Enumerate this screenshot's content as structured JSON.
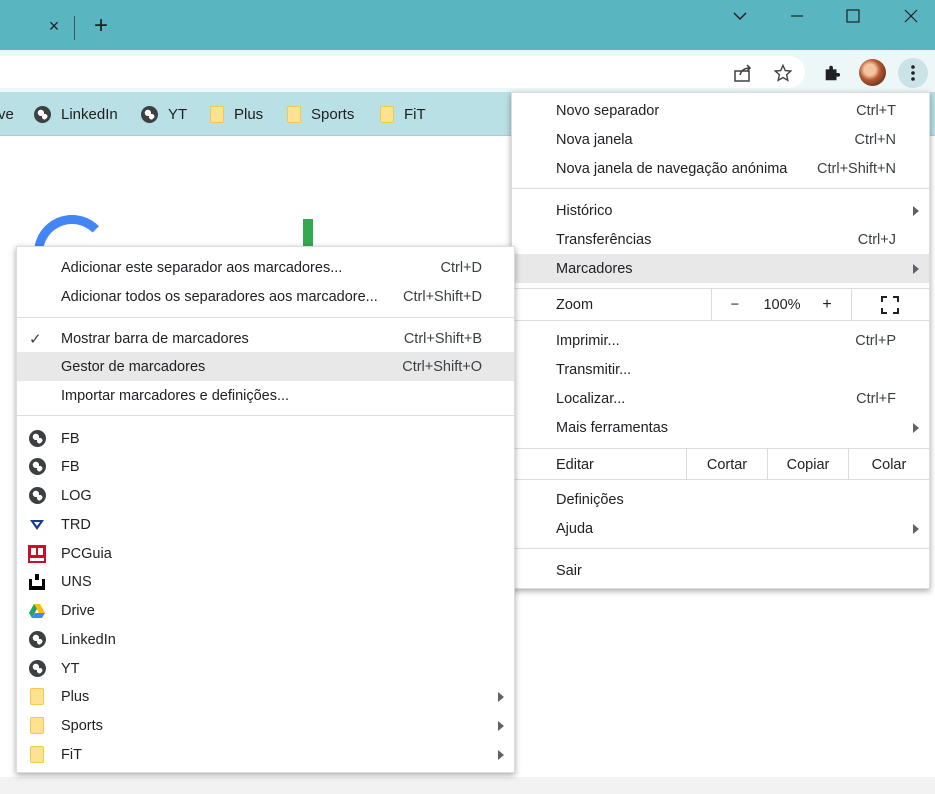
{
  "window": {
    "tab_close_glyph": "×",
    "new_tab_glyph": "+"
  },
  "bookmarks_bar": [
    {
      "label": "ve",
      "icon": "google-drive-icon"
    },
    {
      "label": "LinkedIn",
      "icon": "globe-icon"
    },
    {
      "label": "YT",
      "icon": "globe-icon"
    },
    {
      "label": "Plus",
      "icon": "folder-icon"
    },
    {
      "label": "Sports",
      "icon": "folder-icon"
    },
    {
      "label": "FiT",
      "icon": "folder-icon"
    }
  ],
  "main_menu": {
    "new_tab": {
      "label": "Novo separador",
      "shortcut": "Ctrl+T"
    },
    "new_window": {
      "label": "Nova janela",
      "shortcut": "Ctrl+N"
    },
    "incognito": {
      "label": "Nova janela de navegação anónima",
      "shortcut": "Ctrl+Shift+N"
    },
    "history": {
      "label": "Histórico"
    },
    "downloads": {
      "label": "Transferências",
      "shortcut": "Ctrl+J"
    },
    "bookmarks": {
      "label": "Marcadores"
    },
    "zoom": {
      "label": "Zoom",
      "minus": "−",
      "value": "100%",
      "plus": "+"
    },
    "print": {
      "label": "Imprimir...",
      "shortcut": "Ctrl+P"
    },
    "cast": {
      "label": "Transmitir..."
    },
    "find": {
      "label": "Localizar...",
      "shortcut": "Ctrl+F"
    },
    "more_tools": {
      "label": "Mais ferramentas"
    },
    "edit": {
      "label": "Editar",
      "cut": "Cortar",
      "copy": "Copiar",
      "paste": "Colar"
    },
    "settings": {
      "label": "Definições"
    },
    "help": {
      "label": "Ajuda"
    },
    "exit": {
      "label": "Sair"
    }
  },
  "bookmarks_menu": {
    "add_tab": {
      "label": "Adicionar este separador aos marcadores...",
      "shortcut": "Ctrl+D"
    },
    "add_all": {
      "label": "Adicionar todos os separadores aos marcadore...",
      "shortcut": "Ctrl+Shift+D"
    },
    "show_bar": {
      "label": "Mostrar barra de marcadores",
      "shortcut": "Ctrl+Shift+B"
    },
    "manager": {
      "label": "Gestor de marcadores",
      "shortcut": "Ctrl+Shift+O"
    },
    "import": {
      "label": "Importar marcadores e definições..."
    },
    "items": [
      {
        "label": "FB",
        "icon": "globe-icon"
      },
      {
        "label": "FB",
        "icon": "globe-icon"
      },
      {
        "label": "LOG",
        "icon": "globe-icon"
      },
      {
        "label": "TRD",
        "icon": "trd-icon"
      },
      {
        "label": "PCGuia",
        "icon": "pcguia-icon"
      },
      {
        "label": "UNS",
        "icon": "uns-icon"
      },
      {
        "label": "Drive",
        "icon": "google-drive-icon"
      },
      {
        "label": "LinkedIn",
        "icon": "globe-icon"
      },
      {
        "label": "YT",
        "icon": "globe-icon"
      },
      {
        "label": "Plus",
        "icon": "folder-icon"
      },
      {
        "label": "Sports",
        "icon": "folder-icon"
      },
      {
        "label": "FiT",
        "icon": "folder-icon"
      }
    ]
  },
  "colors": {
    "tabstrip": "#59b6c1",
    "toolbar": "#eef7f8",
    "bookmarks_bar": "#b9e0e5",
    "menu_highlight": "#e8e8e8"
  }
}
